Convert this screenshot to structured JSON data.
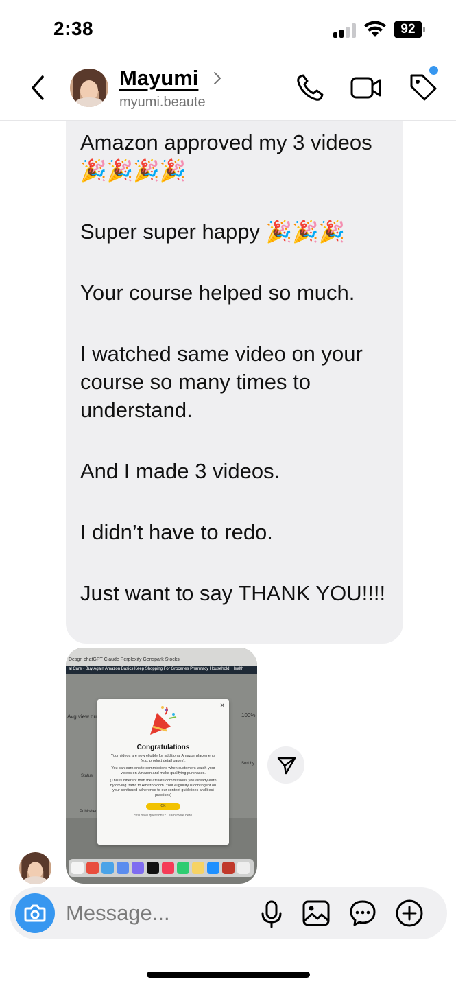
{
  "status_bar": {
    "time": "2:38",
    "battery": "92",
    "signal_bars_active": 2,
    "signal_bars_total": 4
  },
  "header": {
    "contact_name": "Mayumi",
    "contact_handle": "myumi.beaute",
    "back_icon": "chevron-left-icon",
    "call_icon": "phone-icon",
    "video_icon": "video-camera-icon",
    "tag_icon": "tag-icon",
    "notification_dot_color": "#3797f0"
  },
  "message": {
    "paragraphs": [
      "Amazon approved my 3 videos🎉🎉🎉🎉",
      "Super super happy 🎉🎉🎉",
      "Your course helped so much.",
      "I watched same video on your course so many times to understand.",
      "And I made 3 videos.",
      "I didn’t have to redo.",
      "Just want to say THANK YOU!!!!"
    ]
  },
  "attachment": {
    "modal_title": "Congratulations",
    "modal_body_1": "Your videos are now eligible for additional Amazon placements (e.g. product detail pages).",
    "modal_body_2": "You can earn onsite commissions when customers watch your videos on Amazon and make qualifying purchases.",
    "modal_body_3": "(This is different than the affiliate commissions you already earn by driving traffic to Amazon.com. Your eligibility is contingent on your continued adherence to our content guidelines and best practices)",
    "modal_ok": "OK",
    "modal_footer": "Still have questions? Learn more here",
    "bg_label_1": "Avg view dura",
    "bg_label_2": "100%",
    "bg_label_3": "Status",
    "bg_label_4": "Sort by",
    "bg_label_5": "Published",
    "bookmarks": "Desgn   chatGPT   Claude   Perplexity   Genspark   Stocks",
    "navbar": "al Care ·  Buy Again   Amazon Basics   Keep Shopping For   Groceries   Pharmacy   Household, Health"
  },
  "composer": {
    "placeholder": "Message...",
    "camera_icon": "camera-icon",
    "mic_icon": "microphone-icon",
    "gallery_icon": "image-icon",
    "sticker_icon": "message-bubble-icon",
    "plus_icon": "plus-circle-icon",
    "accent_color": "#3797f0"
  }
}
